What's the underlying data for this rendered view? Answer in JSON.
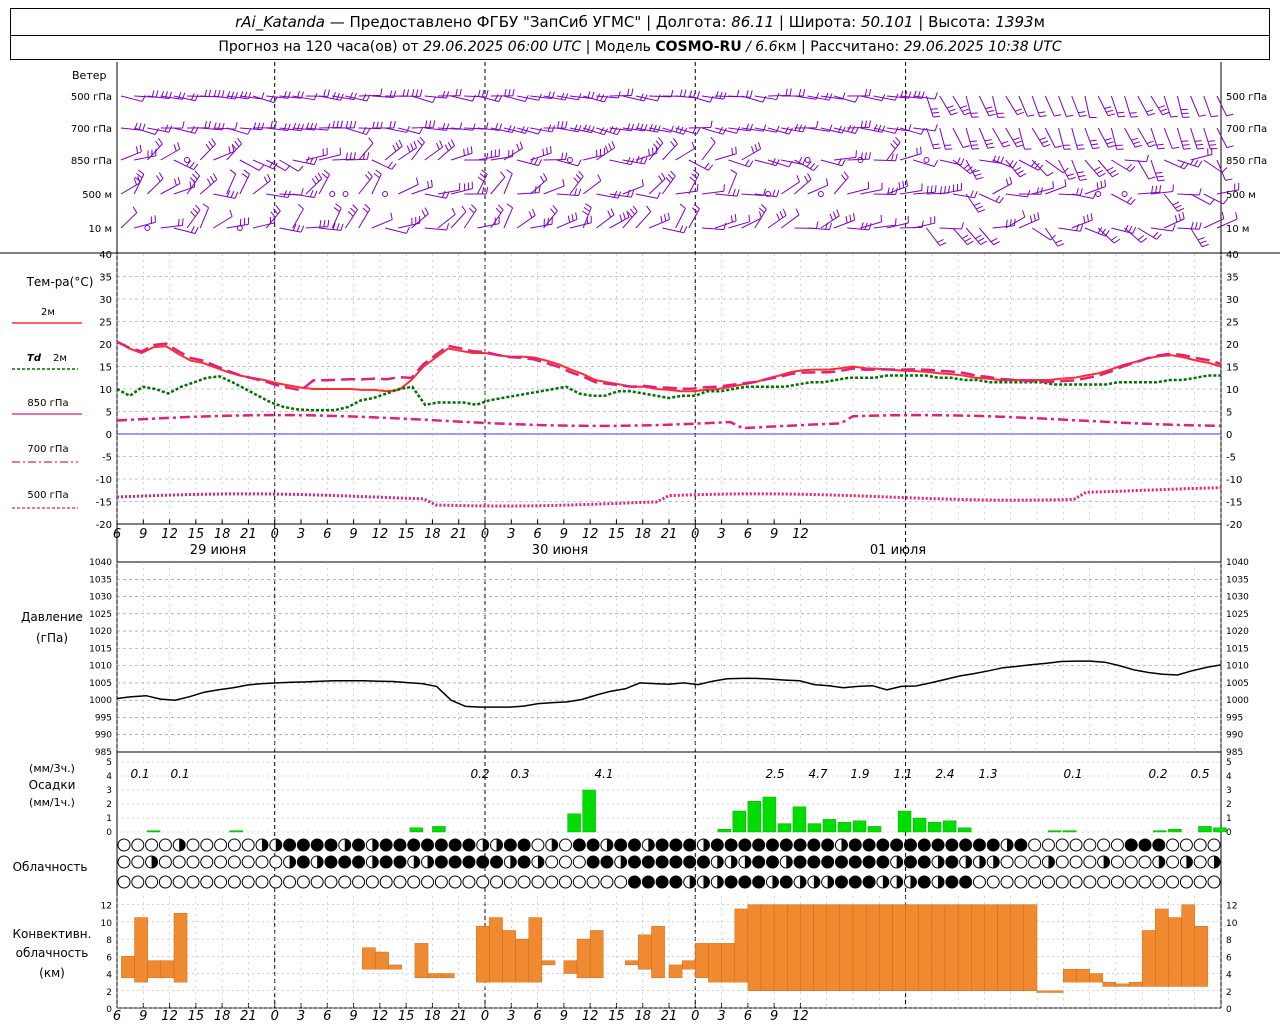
{
  "header": {
    "station": "rAi_Katanda",
    "provider": " — Предоставлено ФГБУ \"ЗапСиб УГМС\" | Долгота: ",
    "lon": "86.11",
    "lat_label": " | Широта: ",
    "lat": "50.101",
    "alt_label": " | Высота: ",
    "alt": "1393",
    "alt_unit": "м",
    "fc_prefix": "Прогноз на 120 часа(ов) от ",
    "fc_time": "29.06.2025 06:00 UTC",
    "model_label": "  | Модель ",
    "model": "COSMO-RU",
    "model_res": " / 6.6",
    "model_res_unit": "км",
    "calc_label": " | Рассчитано: ",
    "calc_time": "29.06.2025 10:38 UTC"
  },
  "labels": {
    "wind": "Ветер",
    "wind_levels": [
      "500 гПа",
      "700 гПа",
      "850 гПа",
      "500 м",
      "10  м"
    ],
    "temp_title": "Тем-ра(°С)",
    "leg_2m": "2м",
    "leg_td": "Td",
    "leg_td2": "2м",
    "leg_850": "850 гПа",
    "leg_700": "700 гПа",
    "leg_500": "500 гПа",
    "press_title": "Давление",
    "press_unit": "(гПа)",
    "precip_u1": "(мм/3ч.)",
    "precip_title": "Осадки",
    "precip_u2": "(мм/1ч.)",
    "cloud_title": "Облачность",
    "conv_1": "Конвективн.",
    "conv_2": "облачность",
    "conv_3": "(км)"
  },
  "time_axis": {
    "hour_labels": [
      "6",
      "9",
      "12",
      "15",
      "18",
      "21",
      "0",
      "3",
      "6",
      "9",
      "12",
      "15",
      "18",
      "21",
      "0",
      "3",
      "6",
      "9",
      "12",
      "15",
      "18",
      "21",
      "0",
      "3",
      "6",
      "9",
      "12"
    ],
    "dates": [
      "29 июня",
      "30 июня",
      "01 июля"
    ]
  },
  "colors": {
    "t2m": "#ff3030",
    "td": "#007000",
    "t850": "#e0207a",
    "t700": "#e0207a",
    "t500": "#e0207a",
    "wind": "#8000c0",
    "precip": "#00dd00",
    "conv": "#f08a30",
    "zero": "#0000ff"
  },
  "chart_data": [
    {
      "type": "line",
      "title": "Тем-ра(°С)",
      "x_hours": [
        0,
        1,
        2,
        3,
        4,
        5,
        6,
        7,
        8,
        9,
        10,
        11,
        12,
        13,
        14,
        15,
        16,
        17,
        18,
        19,
        20,
        21,
        22,
        23,
        24,
        25,
        26,
        27,
        28,
        29,
        30,
        31,
        32,
        33,
        34,
        35,
        36,
        37,
        38,
        39,
        40,
        41,
        42,
        43,
        44,
        45,
        46,
        47,
        48,
        49,
        50,
        51,
        52,
        53,
        54,
        55,
        56,
        57,
        58,
        59,
        60,
        61,
        62,
        63,
        64,
        65,
        66,
        67,
        68,
        69,
        70,
        71,
        72,
        73,
        74,
        75,
        76,
        77,
        78,
        79,
        80,
        81,
        82,
        83,
        84,
        85,
        86,
        87,
        88,
        89,
        90,
        91,
        92,
        93,
        94,
        95,
        96,
        97,
        98,
        99,
        100,
        101,
        102,
        103,
        104,
        105,
        106,
        107,
        108,
        109,
        110,
        111,
        112,
        113,
        114,
        115,
        116,
        117,
        118,
        119,
        120
      ],
      "ylim": [
        -20,
        40
      ],
      "series": [
        {
          "name": "2м",
          "values": [
            20.5,
            19,
            18,
            19.3,
            19.5,
            17.8,
            16.3,
            15.8,
            14.8,
            13.8,
            13,
            12.5,
            12,
            11.3,
            10.8,
            10.3,
            10,
            10,
            10,
            10,
            9.8,
            9.8,
            9.5,
            9.8,
            12,
            15,
            17,
            19,
            18.5,
            18,
            18,
            17.5,
            17.2,
            17.2,
            17,
            16.3,
            15.5,
            14.3,
            13.3,
            12,
            11.5,
            11,
            10.5,
            10.5,
            10,
            9.8,
            9.5,
            9.5,
            9.8,
            10,
            10.5,
            11,
            11.5,
            12.3,
            13,
            13.8,
            14.2,
            14.3,
            14.3,
            14.6,
            15,
            14.6,
            14.5,
            14.3,
            14.1,
            14,
            13.8,
            13.5,
            13.3,
            13,
            12.5,
            12.3,
            12,
            12,
            12,
            12,
            12,
            12.3,
            12.5,
            13,
            13.5,
            14.3,
            15.3,
            16,
            16.8,
            17.3,
            17.5,
            17,
            16.3,
            15.8,
            15
          ],
          "_n": "2m"
        },
        {
          "name": "Td 2м",
          "values": [
            10,
            8.5,
            10.5,
            10,
            9,
            10.5,
            11.5,
            12.5,
            12.8,
            11.5,
            10,
            8.5,
            7,
            6,
            5.5,
            5.3,
            5.3,
            5.3,
            6,
            7.5,
            8,
            9,
            10,
            10.5,
            6.5,
            7,
            7,
            7,
            6.5,
            7.5,
            8,
            8.5,
            9,
            9.5,
            10,
            10.5,
            9,
            8.5,
            8.5,
            9.5,
            9.5,
            9,
            8.5,
            8,
            8.5,
            8.5,
            9.5,
            9.5,
            10,
            10.5,
            10.5,
            10.5,
            10.5,
            11,
            11.5,
            11.5,
            12,
            12.5,
            12.5,
            12.5,
            13,
            13,
            13,
            13,
            12.5,
            12.5,
            12,
            12,
            11.5,
            11.5,
            11.5,
            11.5,
            11.5,
            11,
            11,
            11,
            11,
            11,
            11.5,
            11.5,
            11.5,
            11.5,
            12,
            12,
            12.5,
            13,
            13
          ],
          "_n": "td"
        }
      ]
    }
  ]
}
